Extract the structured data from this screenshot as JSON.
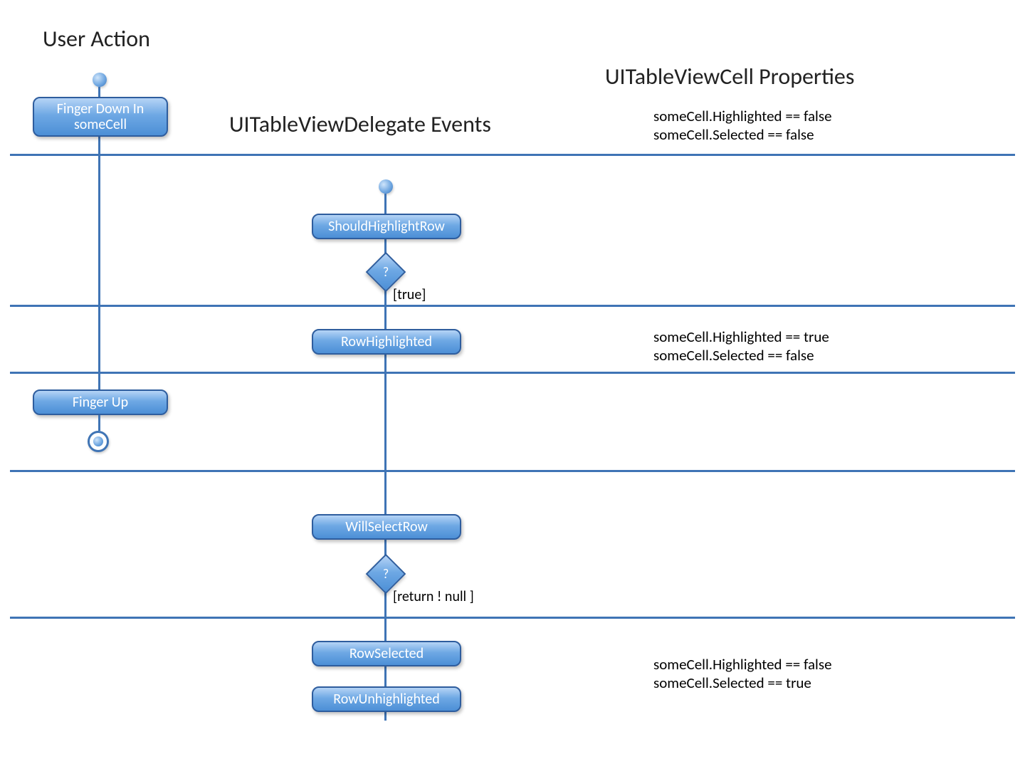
{
  "headings": {
    "user_action": "User Action",
    "delegate_events": "UITableViewDelegate Events",
    "cell_props": "UITableViewCell Properties"
  },
  "nodes": {
    "finger_down": "Finger Down In someCell",
    "finger_up": "Finger Up",
    "should_highlight": "ShouldHighlightRow",
    "row_highlighted": "RowHighlighted",
    "will_select": "WillSelectRow",
    "row_selected": "RowSelected",
    "row_unhighlighted": "RowUnhighlighted"
  },
  "decisions": {
    "q1_label": "?",
    "q1_guard": "[true]",
    "q2_label": "?",
    "q2_guard": "[return ! null ]"
  },
  "props": {
    "state1_a": "someCell.Highlighted == false",
    "state1_b": "someCell.Selected == false",
    "state2_a": "someCell.Highlighted == true",
    "state2_b": "someCell.Selected == false",
    "state3_a": "someCell.Highlighted == false",
    "state3_b": "someCell.Selected == true"
  }
}
